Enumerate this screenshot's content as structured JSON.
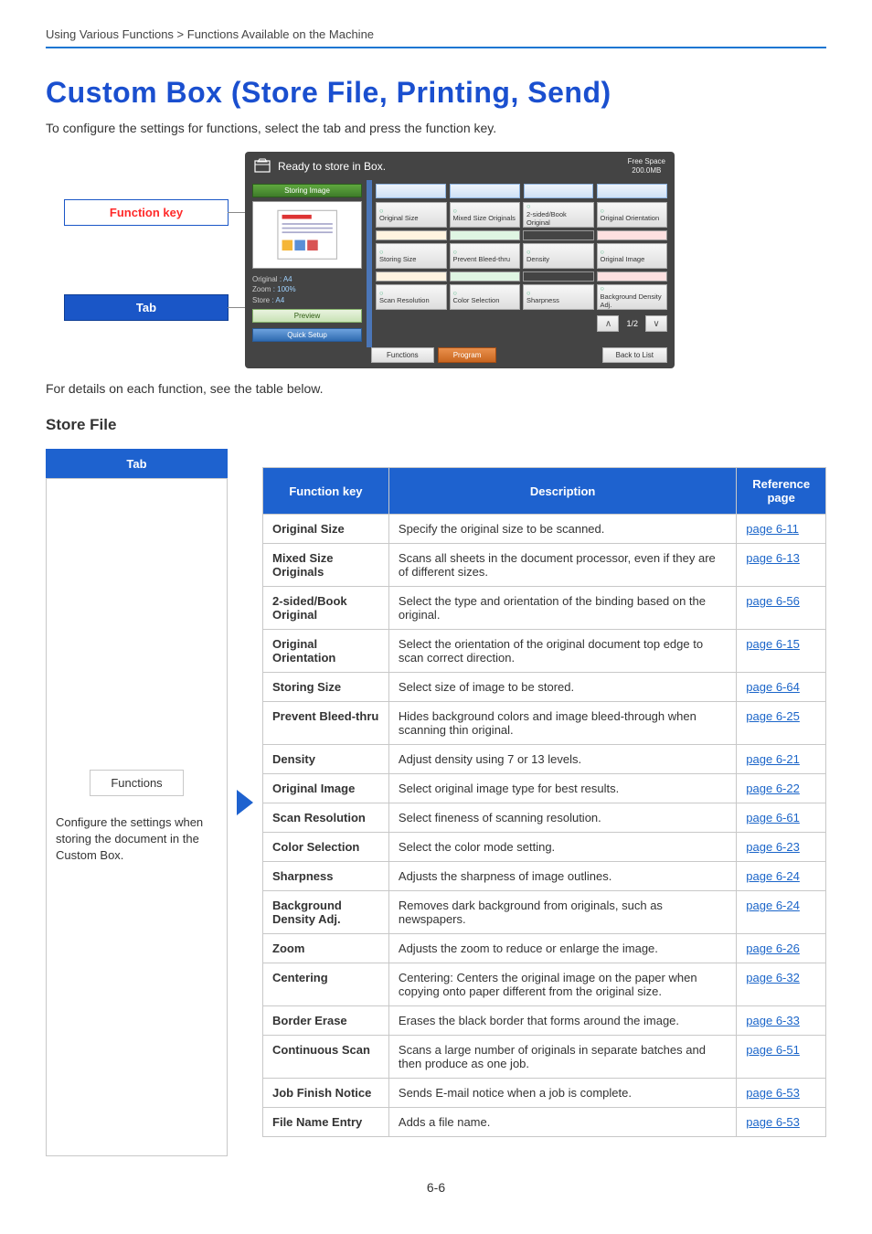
{
  "breadcrumb": "Using Various Functions > Functions Available on the Machine",
  "title": "Custom Box (Store File, Printing, Send)",
  "intro": "To configure the settings for functions, select the tab and press the function key.",
  "labels": {
    "function_key": "Function key",
    "tab": "Tab"
  },
  "panel": {
    "ready": "Ready to store in Box.",
    "free_space_label": "Free Space",
    "free_space_value": "200.0MB",
    "storing_image": "Storing Image",
    "info": {
      "original_k": "Original",
      "original_v": ": A4",
      "zoom_k": "Zoom",
      "zoom_v": ": 100%",
      "store_k": "Store",
      "store_v": ": A4"
    },
    "preview_btn": "Preview",
    "quick_setup": "Quick Setup",
    "grid": [
      [
        "Original Size",
        "Mixed Size Originals",
        "2-sided/Book Original",
        "Original Orientation"
      ],
      [
        "Storing Size",
        "Prevent Bleed-thru",
        "Density",
        "Original Image"
      ],
      [
        "Scan Resolution",
        "Color Selection",
        "Sharpness",
        "Background Density Adj."
      ]
    ],
    "page_ind": "1/2",
    "tabs": {
      "functions": "Functions",
      "program": "Program",
      "back": "Back to List"
    }
  },
  "details_text": "For details on each function, see the table below.",
  "section": "Store File",
  "tabcol": {
    "header": "Tab",
    "fnlabel": "Functions",
    "fndesc": "Configure the settings when storing the document in the Custom Box."
  },
  "table": {
    "headers": {
      "fk": "Function key",
      "desc": "Description",
      "ref": "Reference page"
    },
    "rows": [
      {
        "fk": "Original Size",
        "desc": "Specify the original size to be scanned.",
        "ref": "page 6-11"
      },
      {
        "fk": "Mixed Size Originals",
        "desc": "Scans all sheets in the document processor, even if they are of different sizes.",
        "ref": "page 6-13"
      },
      {
        "fk": "2-sided/Book Original",
        "desc": "Select the type and orientation of the binding based on the original.",
        "ref": "page 6-56"
      },
      {
        "fk": "Original Orientation",
        "desc": "Select the orientation of the original document top edge to scan correct direction.",
        "ref": "page 6-15"
      },
      {
        "fk": "Storing Size",
        "desc": "Select size of image to be stored.",
        "ref": "page 6-64"
      },
      {
        "fk": "Prevent Bleed-thru",
        "desc": "Hides background colors and image bleed-through when scanning thin original.",
        "ref": "page 6-25"
      },
      {
        "fk": "Density",
        "desc": "Adjust density using 7 or 13 levels.",
        "ref": "page 6-21"
      },
      {
        "fk": "Original Image",
        "desc": "Select original image type for best results.",
        "ref": "page 6-22"
      },
      {
        "fk": "Scan Resolution",
        "desc": "Select fineness of scanning resolution.",
        "ref": "page 6-61"
      },
      {
        "fk": "Color Selection",
        "desc": "Select the color mode setting.",
        "ref": "page 6-23"
      },
      {
        "fk": "Sharpness",
        "desc": "Adjusts the sharpness of image outlines.",
        "ref": "page 6-24"
      },
      {
        "fk": "Background Density Adj.",
        "desc": "Removes dark background from originals, such as newspapers.",
        "ref": "page 6-24"
      },
      {
        "fk": "Zoom",
        "desc": "Adjusts the zoom to reduce or enlarge the image.",
        "ref": "page 6-26"
      },
      {
        "fk": "Centering",
        "desc": "Centering:  Centers the original image on the paper when copying onto paper different from the original size.",
        "ref": "page 6-32"
      },
      {
        "fk": "Border Erase",
        "desc": "Erases the black border that forms around the image.",
        "ref": "page 6-33"
      },
      {
        "fk": "Continuous Scan",
        "desc": "Scans a large number of originals in separate batches and then produce as one job.",
        "ref": "page 6-51"
      },
      {
        "fk": "Job Finish Notice",
        "desc": "Sends E-mail notice when a job is complete.",
        "ref": "page 6-53"
      },
      {
        "fk": "File Name Entry",
        "desc": "Adds a file name.",
        "ref": "page 6-53"
      }
    ]
  },
  "footer_page": "6-6"
}
